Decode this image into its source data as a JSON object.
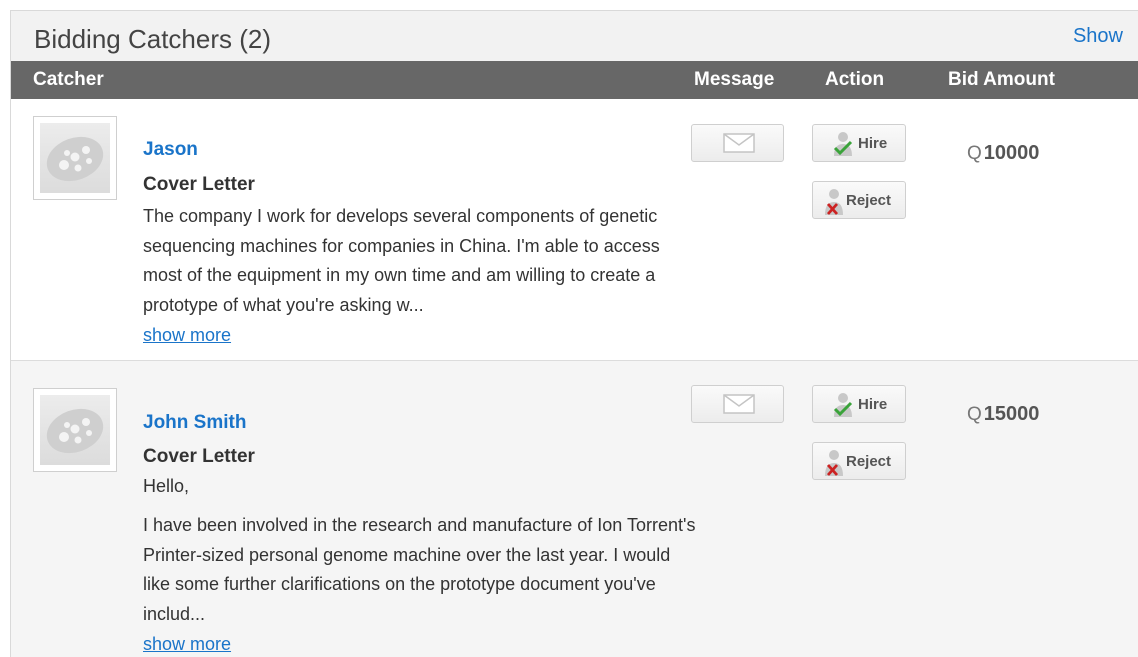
{
  "header": {
    "title": "Bidding Catchers (2)",
    "show_label": "Show"
  },
  "columns": {
    "catcher": "Catcher",
    "message": "Message",
    "action": "Action",
    "bid_amount": "Bid Amount"
  },
  "rows": [
    {
      "name": "Jason",
      "cover_title": "Cover Letter",
      "greeting": "",
      "body": "The company I work for develops several components of genetic sequencing machines for companies in China. I'm able to access most of the equipment in my own time and am willing to create a prototype of what you're asking w...",
      "show_more": "show more",
      "hire_label": "Hire",
      "reject_label": "Reject",
      "currency_symbol": "Q",
      "bid": "10000"
    },
    {
      "name": "John Smith",
      "cover_title": "Cover Letter",
      "greeting": "Hello,",
      "body": "I have been involved in the research and manufacture of Ion Torrent's Printer-sized personal genome machine over the last year. I would like some further clarifications on the prototype document you've includ...",
      "show_more": "show more",
      "hire_label": "Hire",
      "reject_label": "Reject",
      "currency_symbol": "Q",
      "bid": "15000"
    }
  ],
  "icons": {
    "avatar": "default-avatar-icon",
    "message": "envelope-icon",
    "hire": "user-check-icon",
    "reject": "user-x-icon"
  },
  "colors": {
    "link": "#1a74c9",
    "header_bar": "#676767",
    "hire_check": "#3aa33a",
    "reject_x": "#cc2222"
  }
}
